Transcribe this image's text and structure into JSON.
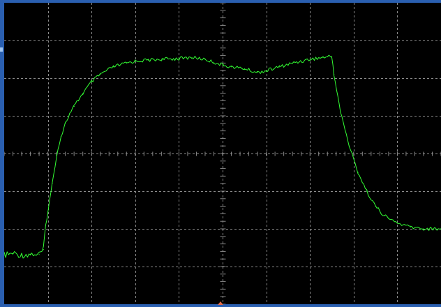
{
  "screen": {
    "background": "#000000",
    "frame_color": "#2a5fb0",
    "grid_color": "#8a8a8a",
    "trace_color": "#33ff33",
    "grid": true,
    "divisions": {
      "x": 10,
      "y": 8
    },
    "minor_ticks_per_division": 5
  },
  "chart_data": {
    "type": "line",
    "title": "",
    "xlabel": "",
    "ylabel": "",
    "xlim": [
      0,
      10
    ],
    "ylim": [
      0,
      8
    ],
    "grid": true,
    "series": [
      {
        "color": "#33ff33",
        "x": [
          0,
          0.2,
          0.4,
          0.6,
          0.8,
          0.9,
          0.95,
          1.0,
          1.1,
          1.2,
          1.3,
          1.4,
          1.5,
          1.6,
          1.8,
          2.0,
          2.2,
          2.5,
          2.8,
          3.0,
          3.3,
          3.6,
          4.0,
          4.3,
          4.6,
          4.8,
          5.0,
          5.2,
          5.5,
          5.8,
          6.0,
          6.3,
          6.6,
          7.0,
          7.3,
          7.5,
          7.55,
          7.7,
          7.9,
          8.1,
          8.3,
          8.5,
          8.7,
          9.0,
          9.3,
          9.6,
          10.0
        ],
        "y": [
          1.3,
          1.35,
          1.3,
          1.33,
          1.32,
          1.45,
          2.1,
          2.45,
          3.2,
          3.95,
          4.45,
          4.8,
          5.05,
          5.25,
          5.6,
          5.9,
          6.1,
          6.3,
          6.4,
          6.45,
          6.48,
          6.5,
          6.52,
          6.55,
          6.5,
          6.42,
          6.35,
          6.3,
          6.25,
          6.15,
          6.2,
          6.3,
          6.4,
          6.5,
          6.55,
          6.58,
          6.1,
          5.1,
          4.2,
          3.5,
          3.0,
          2.6,
          2.35,
          2.15,
          2.05,
          2.0,
          2.0
        ]
      }
    ]
  }
}
